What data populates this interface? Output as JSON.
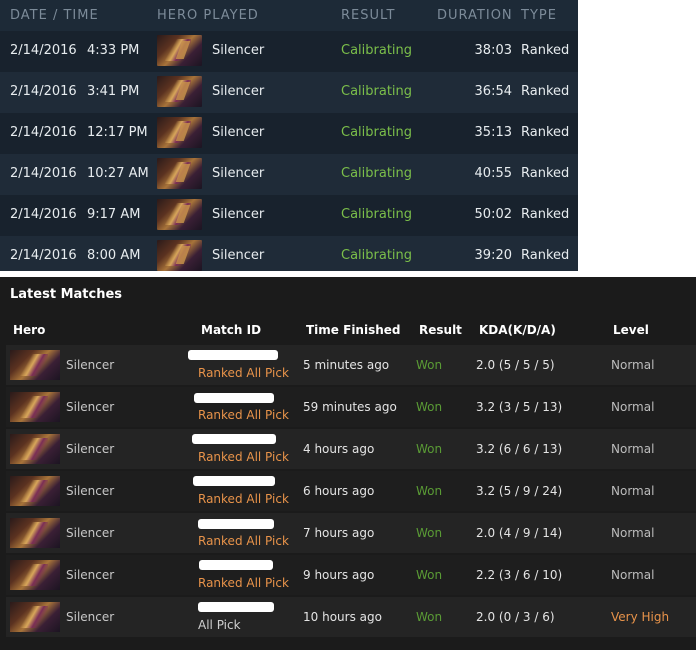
{
  "recent_games": {
    "columns": [
      "DATE / TIME",
      "HERO PLAYED",
      "RESULT",
      "DURATION",
      "TYPE"
    ],
    "rows": [
      {
        "date": "2/14/2016",
        "time": "4:33 PM",
        "hero": "Silencer",
        "result": "Calibrating",
        "duration": "38:03",
        "type": "Ranked"
      },
      {
        "date": "2/14/2016",
        "time": "3:41 PM",
        "hero": "Silencer",
        "result": "Calibrating",
        "duration": "36:54",
        "type": "Ranked"
      },
      {
        "date": "2/14/2016",
        "time": "12:17 PM",
        "hero": "Silencer",
        "result": "Calibrating",
        "duration": "35:13",
        "type": "Ranked"
      },
      {
        "date": "2/14/2016",
        "time": "10:27 AM",
        "hero": "Silencer",
        "result": "Calibrating",
        "duration": "40:55",
        "type": "Ranked"
      },
      {
        "date": "2/14/2016",
        "time": "9:17 AM",
        "hero": "Silencer",
        "result": "Calibrating",
        "duration": "50:02",
        "type": "Ranked"
      },
      {
        "date": "2/14/2016",
        "time": "8:00 AM",
        "hero": "Silencer",
        "result": "Calibrating",
        "duration": "39:20",
        "type": "Ranked"
      }
    ]
  },
  "latest_matches": {
    "title": "Latest Matches",
    "columns": [
      "Hero",
      "Match ID",
      "Time Finished",
      "Result",
      "KDA(K/D/A)",
      "Level"
    ],
    "rows": [
      {
        "hero": "Silencer",
        "mode": "Ranked All Pick",
        "time": "5 minutes ago",
        "result": "Won",
        "kda": "2.0 (5 / 5 / 5)",
        "level": "Normal"
      },
      {
        "hero": "Silencer",
        "mode": "Ranked All Pick",
        "time": "59 minutes ago",
        "result": "Won",
        "kda": "3.2 (3 / 5 / 13)",
        "level": "Normal"
      },
      {
        "hero": "Silencer",
        "mode": "Ranked All Pick",
        "time": "4 hours ago",
        "result": "Won",
        "kda": "3.2 (6 / 6 / 13)",
        "level": "Normal"
      },
      {
        "hero": "Silencer",
        "mode": "Ranked All Pick",
        "time": "6 hours ago",
        "result": "Won",
        "kda": "3.2 (5 / 9 / 24)",
        "level": "Normal"
      },
      {
        "hero": "Silencer",
        "mode": "Ranked All Pick",
        "time": "7 hours ago",
        "result": "Won",
        "kda": "2.0 (4 / 9 / 14)",
        "level": "Normal"
      },
      {
        "hero": "Silencer",
        "mode": "Ranked All Pick",
        "time": "9 hours ago",
        "result": "Won",
        "kda": "2.2 (3 / 6 / 10)",
        "level": "Normal"
      },
      {
        "hero": "Silencer",
        "mode": "All Pick",
        "time": "10 hours ago",
        "result": "Won",
        "kda": "2.0 (0 / 3 / 6)",
        "level": "Very High"
      }
    ]
  },
  "colors": {
    "calibrating": "#7bbf4a",
    "won": "#5a9b35",
    "ranked_pick": "#e8934a",
    "very_high": "#e8934a"
  },
  "icons": {
    "hero_portrait": "silencer-hero-portrait-icon"
  }
}
